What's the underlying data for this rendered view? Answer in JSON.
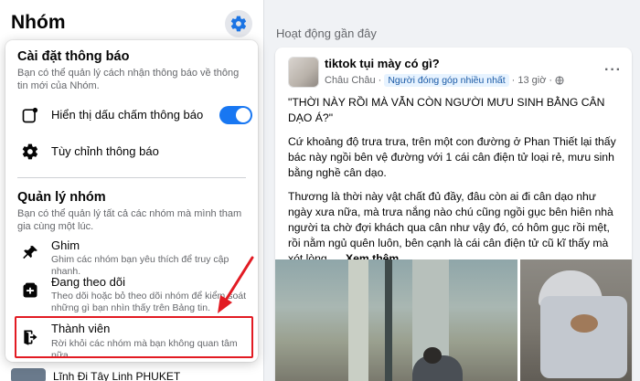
{
  "left_panel": {
    "title": "Nhóm",
    "settings_icon": "gear-icon",
    "peek_text": "Lĩnh Đi Tây Linh PHUKET"
  },
  "menu": {
    "notifications": {
      "title": "Cài đặt thông báo",
      "description": "Bạn có thể quản lý cách nhận thông báo về thông tin mới của Nhóm.",
      "show_dot_label": "Hiển thị dấu chấm thông báo",
      "show_dot_enabled": true,
      "customize_label": "Tùy chỉnh thông báo"
    },
    "manage": {
      "title": "Quản lý nhóm",
      "description": "Bạn có thể quản lý tất cả các nhóm mà mình tham gia cùng một lúc.",
      "items": [
        {
          "label": "Ghim",
          "sub": "Ghim các nhóm bạn yêu thích để truy cập nhanh.",
          "icon": "pin-icon"
        },
        {
          "label": "Đang theo dõi",
          "sub": "Theo dõi hoặc bỏ theo dõi nhóm để kiểm soát những gì bạn nhìn thấy trên Bảng tin.",
          "icon": "follow-icon"
        },
        {
          "label": "Thành viên",
          "sub": "Rời khỏi các nhóm mà bạn không quan tâm nữa.",
          "icon": "leave-icon"
        }
      ]
    },
    "highlight_color": "#e21b23"
  },
  "feed": {
    "section_title": "Hoạt động gần đây",
    "post": {
      "group_name": "tiktok tụi mày có gì?",
      "author": "Châu Châu",
      "badge": "Người đóng góp nhiều nhất",
      "time": "13 giờ",
      "more": "···",
      "paragraphs": [
        "\"THỜI NÀY RỒI MÀ VẪN CÒN NGƯỜI MƯU SINH BẰNG CÂN DẠO Á?\"",
        "Cứ khoảng độ trưa trưa, trên một con đường ở Phan Thiết lại thấy bác này ngồi bên vệ đường với 1 cái cân điện tử loại rẻ, mưu sinh bằng nghề cân dạo.",
        "Thương là thời này vật chất đủ đầy, đâu còn ai đi cân dạo như ngày xưa nữa, mà trưa nắng nào chú cũng ngồi gục bên hiên nhà người ta chờ đợi khách qua cân như vậy đó, có hôm gục rồi mệt, rồi nằm ngủ quên luôn, bên cạnh là cái cân điện tử cũ kĩ thấy mà xót lòng. ..."
      ],
      "see_more": "Xem thêm"
    }
  },
  "colors": {
    "accent": "#1877f2",
    "background": "#f0f2f5",
    "muted_text": "#65676b"
  }
}
